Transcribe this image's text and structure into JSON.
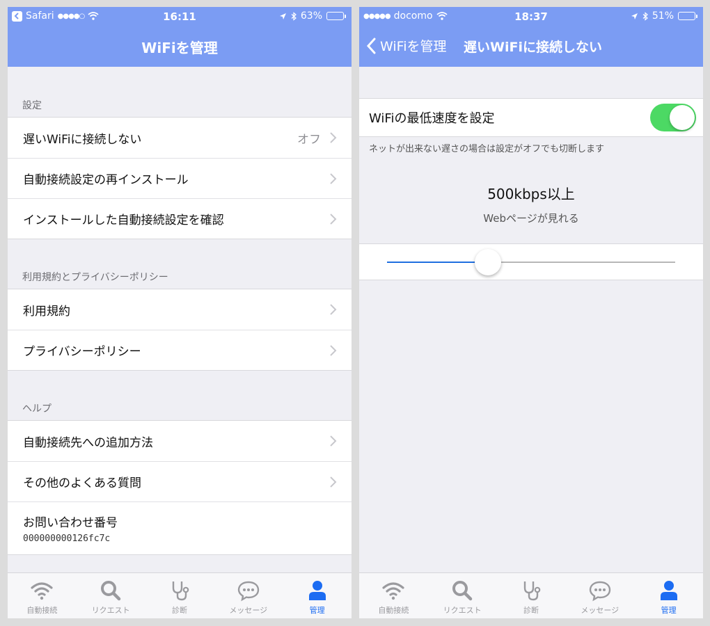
{
  "left": {
    "status": {
      "carrier": "Safari",
      "time": "16:11",
      "battery": "63%",
      "battery_level": 0.63
    },
    "title": "WiFiを管理",
    "sections": [
      {
        "header": "設定",
        "rows": [
          {
            "label": "遅いWiFiに接続しない",
            "value": "オフ"
          },
          {
            "label": "自動接続設定の再インストール",
            "value": ""
          },
          {
            "label": "インストールした自動接続設定を確認",
            "value": ""
          }
        ]
      },
      {
        "header": "利用規約とプライバシーポリシー",
        "rows": [
          {
            "label": "利用規約",
            "value": ""
          },
          {
            "label": "プライバシーポリシー",
            "value": ""
          }
        ]
      },
      {
        "header": "ヘルプ",
        "rows": [
          {
            "label": "自動接続先への追加方法",
            "value": ""
          },
          {
            "label": "その他のよくある質問",
            "value": ""
          }
        ]
      }
    ],
    "inquiry": {
      "label": "お問い合わせ番号",
      "number": "000000000126fc7c"
    }
  },
  "right": {
    "status": {
      "carrier": "docomo",
      "time": "18:37",
      "battery": "51%",
      "battery_level": 0.51
    },
    "back_label": "WiFiを管理",
    "title": "遅いWiFiに接続しない",
    "toggle_label": "WiFiの最低速度を設定",
    "toggle_on": true,
    "footnote": "ネットが出来ない遅さの場合は設定がオフでも切断します",
    "speed_value": "500kbps以上",
    "speed_desc": "Webページが見れる",
    "slider_level": 0.35
  },
  "tabs": [
    {
      "label": "自動接続",
      "icon": "wifi-icon",
      "active": false
    },
    {
      "label": "リクエスト",
      "icon": "search-icon",
      "active": false
    },
    {
      "label": "診断",
      "icon": "stethoscope-icon",
      "active": false
    },
    {
      "label": "メッセージ",
      "icon": "chat-bubble-icon",
      "active": false
    },
    {
      "label": "管理",
      "icon": "person-icon",
      "active": true
    }
  ],
  "colors": {
    "nav": "#7b9cf3",
    "tab_active": "#1c6cf2",
    "tab_inactive": "#9a9a9e",
    "toggle_on": "#4cd964",
    "slider_fill": "#1f6fe0"
  }
}
